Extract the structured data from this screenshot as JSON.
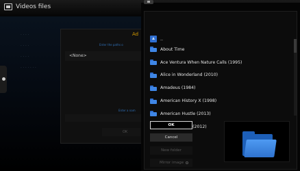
{
  "header": {
    "title": "Videos  files"
  },
  "background_sidebar": {
    "items": [
      "· · · ·",
      "· · · ·",
      "· · · ·",
      "· · · · · · ·"
    ]
  },
  "add_source": {
    "title_fragment": "Ad",
    "hint": "Enter the paths o",
    "none_label": "<None>",
    "name_hint": "Enter a nam",
    "ok_label": "OK"
  },
  "browse": {
    "parent_label": "..",
    "items": [
      "About Time",
      "Ace Ventura When Nature Calls (1995)",
      "Alice in Wonderland (2010)",
      "Amadeus (1984)",
      "American History X (1998)",
      "American Hustle (2013)",
      "Anna Karenina (2012)"
    ],
    "buttons": {
      "ok": "OK",
      "cancel": "Cancel",
      "new_folder": "New folder",
      "mirror_image": "Mirror image"
    }
  }
}
